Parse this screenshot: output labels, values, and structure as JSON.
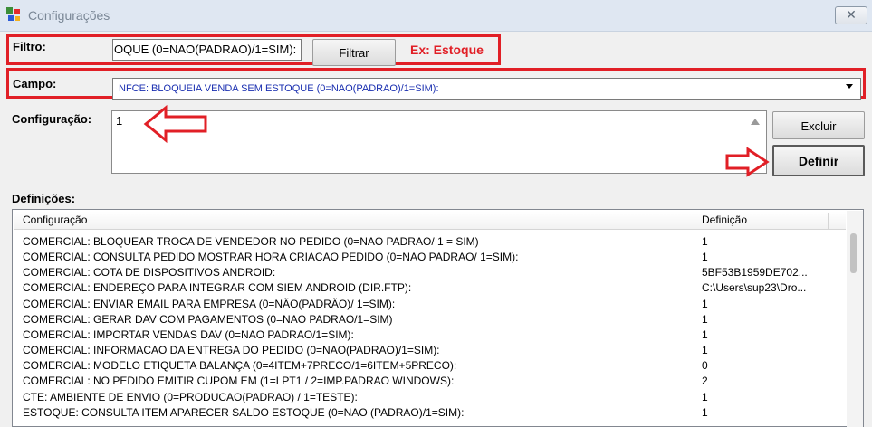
{
  "window": {
    "title": "Configurações",
    "close_glyph": "✕"
  },
  "filtro": {
    "label": "Filtro:",
    "value": "OQUE (0=NAO(PADRAO)/1=SIM):",
    "button": "Filtrar",
    "example": "Ex: Estoque"
  },
  "campo": {
    "label": "Campo:",
    "selected": "NFCE: BLOQUEIA VENDA SEM ESTOQUE (0=NAO(PADRAO)/1=SIM):"
  },
  "configuracao": {
    "label": "Configuração:",
    "value": "1",
    "excluir": "Excluir",
    "definir": "Definir"
  },
  "definicoes": {
    "label": "Definições:",
    "columns": [
      "Configuração",
      "Definição"
    ],
    "rows": [
      [
        "COMERCIAL: BLOQUEAR TROCA DE VENDEDOR NO PEDIDO (0=NAO PADRAO/ 1 = SIM)",
        "1"
      ],
      [
        "COMERCIAL: CONSULTA PEDIDO MOSTRAR HORA CRIACAO PEDIDO (0=NAO PADRAO/ 1=SIM):",
        "1"
      ],
      [
        "COMERCIAL: COTA DE DISPOSITIVOS ANDROID:",
        "5BF53B1959DE702..."
      ],
      [
        "COMERCIAL: ENDEREÇO PARA INTEGRAR COM SIEM ANDROID (DIR.FTP):",
        "C:\\Users\\sup23\\Dro..."
      ],
      [
        "COMERCIAL: ENVIAR EMAIL PARA EMPRESA (0=NÃO(PADRÃO)/ 1=SIM):",
        "1"
      ],
      [
        "COMERCIAL: GERAR DAV COM PAGAMENTOS (0=NAO PADRAO/1=SIM)",
        "1"
      ],
      [
        "COMERCIAL: IMPORTAR VENDAS DAV (0=NAO PADRAO/1=SIM):",
        "1"
      ],
      [
        "COMERCIAL: INFORMACAO DA ENTREGA DO PEDIDO (0=NAO(PADRAO)/1=SIM):",
        "1"
      ],
      [
        "COMERCIAL: MODELO ETIQUETA BALANÇA (0=4ITEM+7PRECO/1=6ITEM+5PRECO):",
        "0"
      ],
      [
        "COMERCIAL: NO PEDIDO EMITIR CUPOM EM (1=LPT1 / 2=IMP.PADRAO WINDOWS):",
        "2"
      ],
      [
        "CTE: AMBIENTE DE ENVIO (0=PRODUCAO(PADRAO) / 1=TESTE):",
        "1"
      ],
      [
        "ESTOQUE: CONSULTA ITEM APARECER SALDO ESTOQUE (0=NAO (PADRAO)/1=SIM):",
        "1"
      ]
    ]
  },
  "colors": {
    "highlight": "#e11f26",
    "campo_text": "#1a2fb0"
  }
}
